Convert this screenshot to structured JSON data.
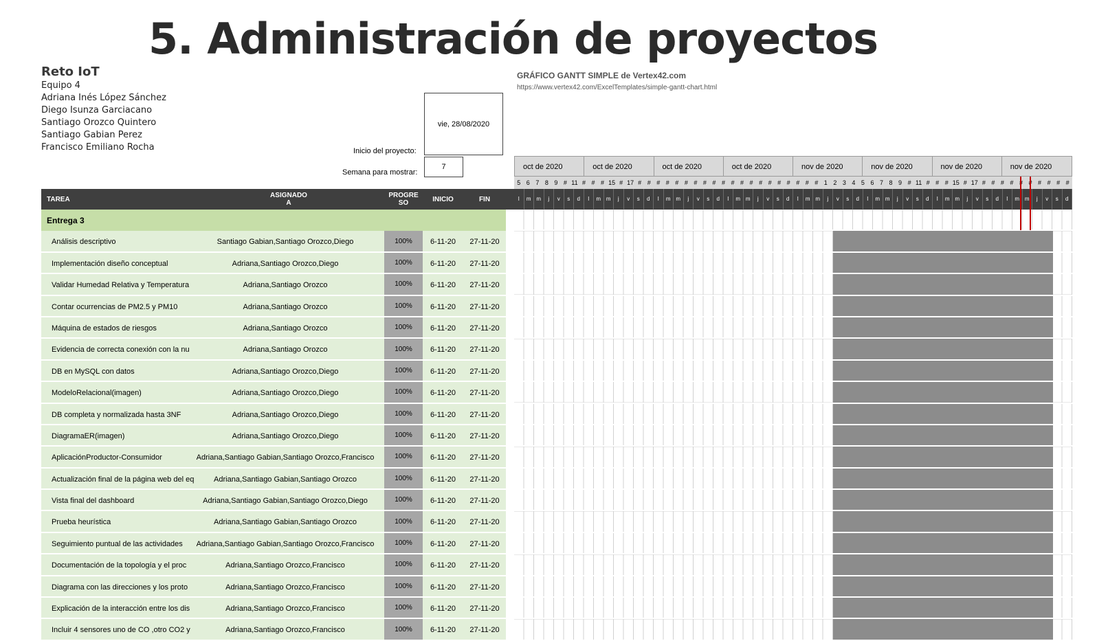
{
  "page": {
    "title": "5. Administración de proyectos"
  },
  "project": {
    "name": "Reto IoT",
    "team": "Equipo 4",
    "members": [
      "Adriana Inés López Sánchez",
      "Diego Isunza Garciacano",
      "Santiago Orozco Quintero",
      "Santiago Gabian Perez",
      "Francisco Emiliano Rocha"
    ],
    "start_label": "Inicio del proyecto:",
    "start_date": "vie, 28/08/2020",
    "week_label": "Semana para mostrar:",
    "week_value": "7"
  },
  "gantt": {
    "title": "GRÁFICO GANTT SIMPLE de Vertex42.com",
    "link": "https://www.vertex42.com/ExcelTemplates/simple-gantt-chart.html",
    "months": [
      "oct de 2020",
      "oct de 2020",
      "oct de 2020",
      "oct de 2020",
      "nov de 2020",
      "nov de 2020",
      "nov de 2020",
      "nov de 2020"
    ],
    "day_numbers": [
      "5",
      "6",
      "7",
      "8",
      "9",
      "#",
      "11",
      "#",
      "#",
      "#",
      "15",
      "#",
      "17",
      "#",
      "#",
      "#",
      "#",
      "#",
      "#",
      "#",
      "#",
      "#",
      "#",
      "#",
      "#",
      "#",
      "#",
      "#",
      "#",
      "#",
      "#",
      "#",
      "#",
      "1",
      "2",
      "3",
      "4",
      "5",
      "6",
      "7",
      "8",
      "9",
      "#",
      "11",
      "#",
      "#",
      "#",
      "15",
      "#",
      "17",
      "#",
      "#",
      "#",
      "#",
      "#",
      "#",
      "#",
      "#",
      "#",
      "#"
    ],
    "day_letters": [
      "l",
      "m",
      "m",
      "j",
      "v",
      "s",
      "d",
      "l",
      "m",
      "m",
      "j",
      "v",
      "s",
      "d",
      "l",
      "m",
      "m",
      "j",
      "v",
      "s",
      "d",
      "l",
      "m",
      "m",
      "j",
      "v",
      "s",
      "d",
      "l",
      "m",
      "m",
      "j",
      "v",
      "s",
      "d",
      "l",
      "m",
      "m",
      "j",
      "v",
      "s",
      "d",
      "l",
      "m",
      "m",
      "j",
      "v",
      "s",
      "d",
      "l",
      "m",
      "m",
      "j",
      "v",
      "s",
      "d"
    ]
  },
  "columns": {
    "task": "TAREA",
    "assigned": "ASIGNADO\nA",
    "progress": "PROGRE\nSO",
    "start": "INICIO",
    "end": "FIN"
  },
  "phase": {
    "name": "Entrega 3"
  },
  "tasks": [
    {
      "name": "Análisis descriptivo",
      "assigned": "Santiago Gabian,Santiago Orozco,Diego",
      "progress": "100%",
      "start": "6-11-20",
      "end": "27-11-20"
    },
    {
      "name": "Implementación diseño conceptual",
      "assigned": "Adriana,Santiago Orozco,Diego",
      "progress": "100%",
      "start": "6-11-20",
      "end": "27-11-20"
    },
    {
      "name": "Validar Humedad Relativa y Temperatura",
      "assigned": "Adriana,Santiago Orozco",
      "progress": "100%",
      "start": "6-11-20",
      "end": "27-11-20"
    },
    {
      "name": "Contar ocurrencias de PM2.5 y PM10",
      "assigned": "Adriana,Santiago Orozco",
      "progress": "100%",
      "start": "6-11-20",
      "end": "27-11-20"
    },
    {
      "name": "Máquina de estados de riesgos",
      "assigned": "Adriana,Santiago Orozco",
      "progress": "100%",
      "start": "6-11-20",
      "end": "27-11-20"
    },
    {
      "name": "Evidencia de correcta conexión con la nu",
      "assigned": "Adriana,Santiago Orozco",
      "progress": "100%",
      "start": "6-11-20",
      "end": "27-11-20"
    },
    {
      "name": "DB en MySQL con datos",
      "assigned": "Adriana,Santiago Orozco,Diego",
      "progress": "100%",
      "start": "6-11-20",
      "end": "27-11-20"
    },
    {
      "name": "ModeloRelacional(imagen)",
      "assigned": "Adriana,Santiago Orozco,Diego",
      "progress": "100%",
      "start": "6-11-20",
      "end": "27-11-20"
    },
    {
      "name": "DB completa y normalizada hasta 3NF",
      "assigned": "Adriana,Santiago Orozco,Diego",
      "progress": "100%",
      "start": "6-11-20",
      "end": "27-11-20"
    },
    {
      "name": "DiagramaER(imagen)",
      "assigned": "Adriana,Santiago Orozco,Diego",
      "progress": "100%",
      "start": "6-11-20",
      "end": "27-11-20"
    },
    {
      "name": "AplicaciónProductor-Consumidor",
      "assigned": "Adriana,Santiago Gabian,Santiago Orozco,Francisco",
      "progress": "100%",
      "start": "6-11-20",
      "end": "27-11-20"
    },
    {
      "name": "Actualización final de la página web del eq",
      "assigned": "Adriana,Santiago Gabian,Santiago Orozco",
      "progress": "100%",
      "start": "6-11-20",
      "end": "27-11-20"
    },
    {
      "name": "Vista final del dashboard",
      "assigned": "Adriana,Santiago Gabian,Santiago Orozco,Diego",
      "progress": "100%",
      "start": "6-11-20",
      "end": "27-11-20"
    },
    {
      "name": "Prueba heurística",
      "assigned": "Adriana,Santiago Gabian,Santiago Orozco",
      "progress": "100%",
      "start": "6-11-20",
      "end": "27-11-20"
    },
    {
      "name": "Seguimiento puntual de las actividades",
      "assigned": "Adriana,Santiago Gabian,Santiago Orozco,Francisco",
      "progress": "100%",
      "start": "6-11-20",
      "end": "27-11-20"
    },
    {
      "name": "Documentación de la topología y el proc",
      "assigned": "Adriana,Santiago Orozco,Francisco",
      "progress": "100%",
      "start": "6-11-20",
      "end": "27-11-20"
    },
    {
      "name": "Diagrama con las direcciones y los proto",
      "assigned": "Adriana,Santiago Orozco,Francisco",
      "progress": "100%",
      "start": "6-11-20",
      "end": "27-11-20"
    },
    {
      "name": "Explicación de la interacción entre los dis",
      "assigned": "Adriana,Santiago Orozco,Francisco",
      "progress": "100%",
      "start": "6-11-20",
      "end": "27-11-20"
    },
    {
      "name": "Incluir 4 sensores uno de CO ,otro CO2 y",
      "assigned": "Adriana,Santiago Orozco,Francisco",
      "progress": "100%",
      "start": "6-11-20",
      "end": "27-11-20"
    }
  ]
}
